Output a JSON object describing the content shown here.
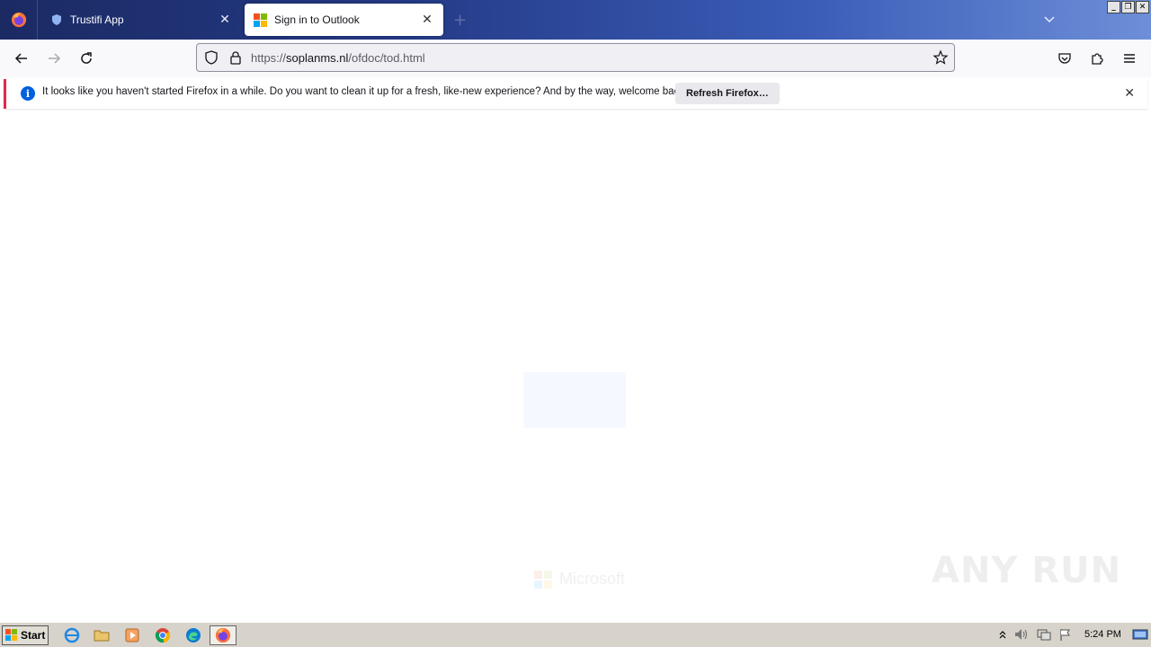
{
  "browser": {
    "tabs": [
      {
        "label": "Trustifi App",
        "active": false
      },
      {
        "label": "Sign in to Outlook",
        "active": true
      }
    ],
    "url": {
      "scheme": "https://",
      "domain": "soplanms.nl",
      "path": "/ofdoc/tod.html"
    },
    "accent_color": "#0060df"
  },
  "notification": {
    "message": "It looks like you haven't started Firefox in a while. Do you want to clean it up for a fresh, like-new experience? And by the way, welcome back!",
    "button_label": "Refresh Firefox…"
  },
  "page": {
    "footer_brand": "Microsoft",
    "watermark": "ANY RUN"
  },
  "taskbar": {
    "start_label": "Start",
    "pinned": [
      "internet-explorer-icon",
      "folder-icon",
      "media-player-icon",
      "chrome-icon",
      "edge-icon",
      "firefox-icon"
    ],
    "clock": "5:24 PM"
  }
}
